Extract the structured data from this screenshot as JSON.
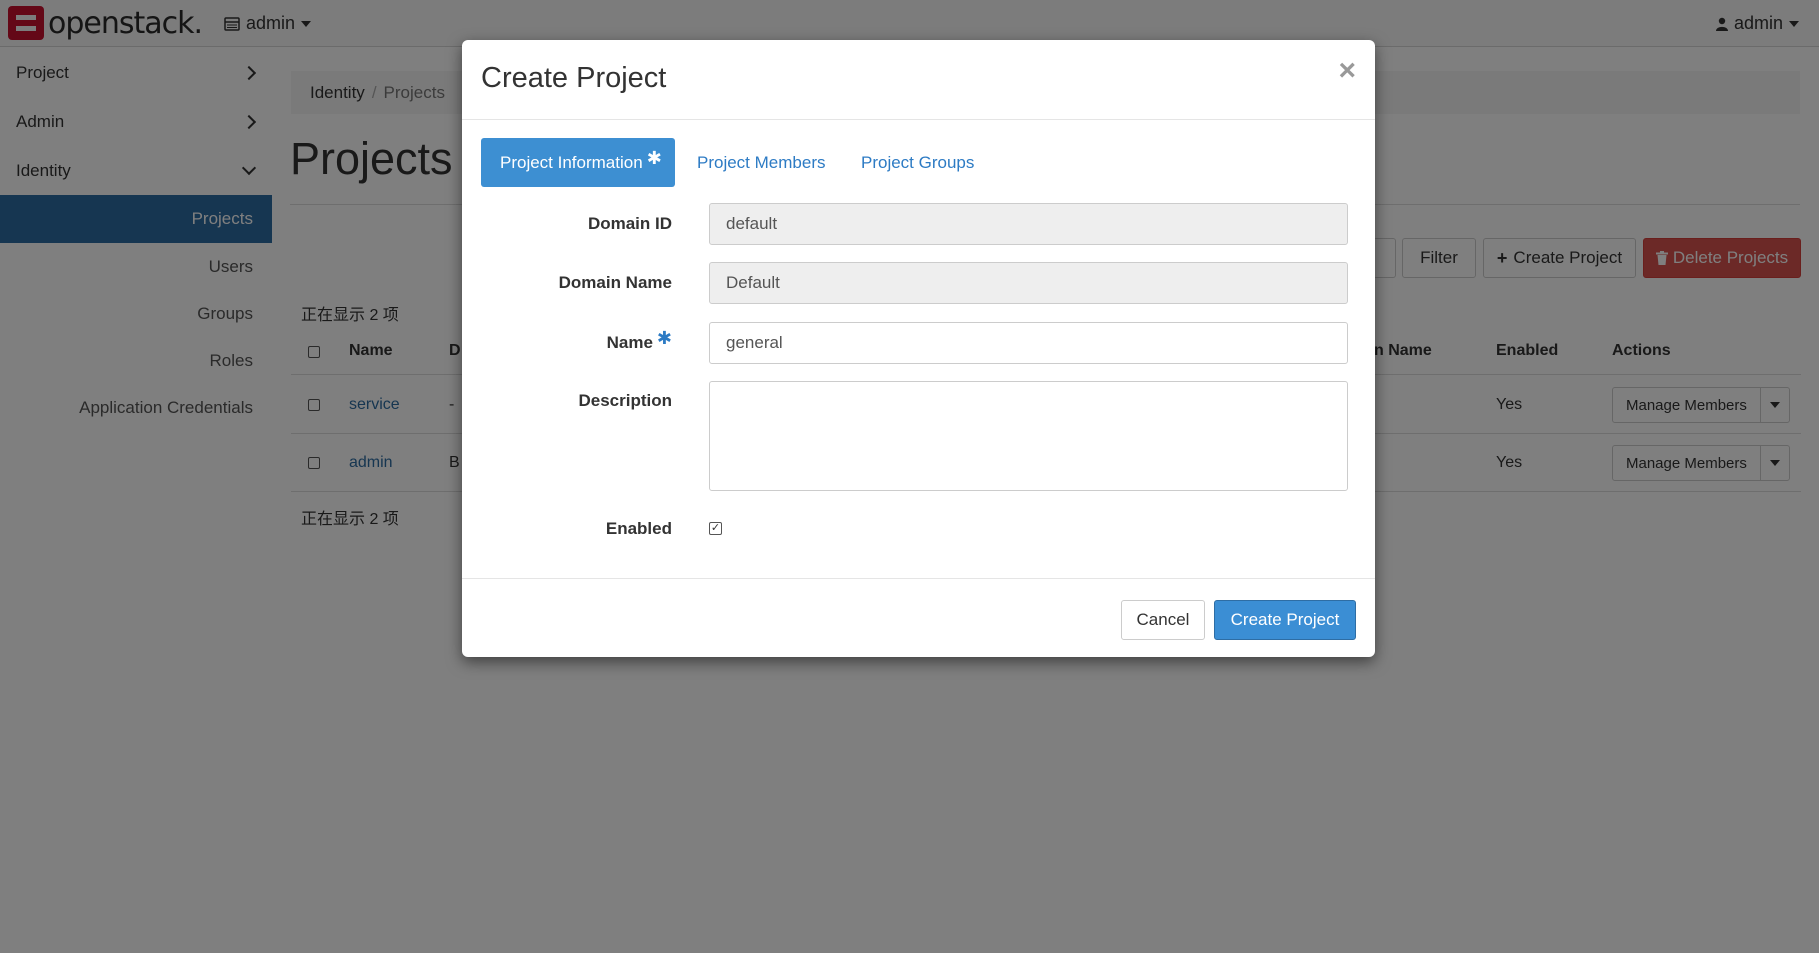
{
  "navbar": {
    "logo_text": "openstack.",
    "project_menu": "admin",
    "user_menu": "admin"
  },
  "sidebar": {
    "sections": [
      {
        "label": "Project"
      },
      {
        "label": "Admin"
      },
      {
        "label": "Identity"
      }
    ],
    "identity_items": [
      {
        "label": "Projects",
        "active": true
      },
      {
        "label": "Users"
      },
      {
        "label": "Groups"
      },
      {
        "label": "Roles"
      },
      {
        "label": "Application Credentials"
      }
    ]
  },
  "breadcrumb": {
    "items": [
      "Identity",
      "Projects"
    ]
  },
  "page": {
    "title": "Projects",
    "filter_label": "Filter",
    "create_label": "Create Project",
    "delete_label": "Delete Projects",
    "count_text": "正在显示 2 项"
  },
  "table": {
    "columns": [
      "Name",
      "D",
      "n Name",
      "Enabled",
      "Actions"
    ],
    "rows": [
      {
        "name": "service",
        "description": "-",
        "enabled": "Yes",
        "action": "Manage Members"
      },
      {
        "name": "admin",
        "description": "B",
        "enabled": "Yes",
        "action": "Manage Members"
      }
    ]
  },
  "modal": {
    "title": "Create Project",
    "close_symbol": "×",
    "tabs": [
      "Project Information",
      "Project Members",
      "Project Groups"
    ],
    "required_mark": "✱",
    "fields": {
      "domain_id": {
        "label": "Domain ID",
        "value": "default"
      },
      "domain_name": {
        "label": "Domain Name",
        "value": "Default"
      },
      "name": {
        "label": "Name",
        "value": "general"
      },
      "description": {
        "label": "Description",
        "value": ""
      },
      "enabled": {
        "label": "Enabled",
        "checked": true
      }
    },
    "cancel_label": "Cancel",
    "submit_label": "Create Project"
  },
  "colors": {
    "primary": "#3b8ed4",
    "sidebar_active": "#2d6ca2",
    "danger": "#d9534f",
    "brand_red": "#c8102e"
  }
}
